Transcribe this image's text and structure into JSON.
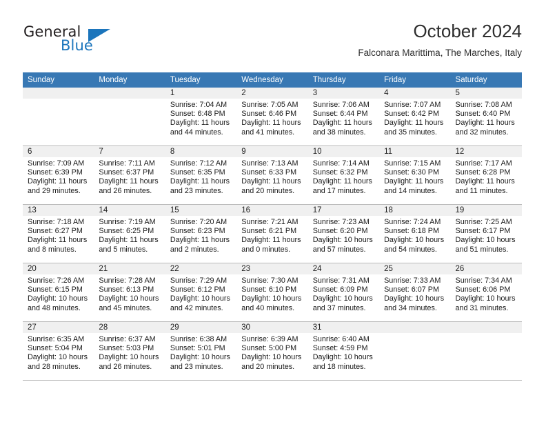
{
  "brand": {
    "name_top": "General",
    "name_bottom": "Blue",
    "accent_color": "#1b75bc"
  },
  "header": {
    "title": "October 2024",
    "subtitle": "Falconara Marittima, The Marches, Italy"
  },
  "theme": {
    "header_row_bg": "#3878b4",
    "daynum_band_bg": "#f0f0f0",
    "grid_line": "#b9b9b9",
    "text": "#1a1a1a"
  },
  "calendar": {
    "weekday_headers": [
      "Sunday",
      "Monday",
      "Tuesday",
      "Wednesday",
      "Thursday",
      "Friday",
      "Saturday"
    ],
    "weeks": [
      [
        {
          "day": "",
          "sunrise": "",
          "sunset": "",
          "daylight_1": "",
          "daylight_2": ""
        },
        {
          "day": "",
          "sunrise": "",
          "sunset": "",
          "daylight_1": "",
          "daylight_2": ""
        },
        {
          "day": "1",
          "sunrise": "Sunrise: 7:04 AM",
          "sunset": "Sunset: 6:48 PM",
          "daylight_1": "Daylight: 11 hours",
          "daylight_2": "and 44 minutes."
        },
        {
          "day": "2",
          "sunrise": "Sunrise: 7:05 AM",
          "sunset": "Sunset: 6:46 PM",
          "daylight_1": "Daylight: 11 hours",
          "daylight_2": "and 41 minutes."
        },
        {
          "day": "3",
          "sunrise": "Sunrise: 7:06 AM",
          "sunset": "Sunset: 6:44 PM",
          "daylight_1": "Daylight: 11 hours",
          "daylight_2": "and 38 minutes."
        },
        {
          "day": "4",
          "sunrise": "Sunrise: 7:07 AM",
          "sunset": "Sunset: 6:42 PM",
          "daylight_1": "Daylight: 11 hours",
          "daylight_2": "and 35 minutes."
        },
        {
          "day": "5",
          "sunrise": "Sunrise: 7:08 AM",
          "sunset": "Sunset: 6:40 PM",
          "daylight_1": "Daylight: 11 hours",
          "daylight_2": "and 32 minutes."
        }
      ],
      [
        {
          "day": "6",
          "sunrise": "Sunrise: 7:09 AM",
          "sunset": "Sunset: 6:39 PM",
          "daylight_1": "Daylight: 11 hours",
          "daylight_2": "and 29 minutes."
        },
        {
          "day": "7",
          "sunrise": "Sunrise: 7:11 AM",
          "sunset": "Sunset: 6:37 PM",
          "daylight_1": "Daylight: 11 hours",
          "daylight_2": "and 26 minutes."
        },
        {
          "day": "8",
          "sunrise": "Sunrise: 7:12 AM",
          "sunset": "Sunset: 6:35 PM",
          "daylight_1": "Daylight: 11 hours",
          "daylight_2": "and 23 minutes."
        },
        {
          "day": "9",
          "sunrise": "Sunrise: 7:13 AM",
          "sunset": "Sunset: 6:33 PM",
          "daylight_1": "Daylight: 11 hours",
          "daylight_2": "and 20 minutes."
        },
        {
          "day": "10",
          "sunrise": "Sunrise: 7:14 AM",
          "sunset": "Sunset: 6:32 PM",
          "daylight_1": "Daylight: 11 hours",
          "daylight_2": "and 17 minutes."
        },
        {
          "day": "11",
          "sunrise": "Sunrise: 7:15 AM",
          "sunset": "Sunset: 6:30 PM",
          "daylight_1": "Daylight: 11 hours",
          "daylight_2": "and 14 minutes."
        },
        {
          "day": "12",
          "sunrise": "Sunrise: 7:17 AM",
          "sunset": "Sunset: 6:28 PM",
          "daylight_1": "Daylight: 11 hours",
          "daylight_2": "and 11 minutes."
        }
      ],
      [
        {
          "day": "13",
          "sunrise": "Sunrise: 7:18 AM",
          "sunset": "Sunset: 6:27 PM",
          "daylight_1": "Daylight: 11 hours",
          "daylight_2": "and 8 minutes."
        },
        {
          "day": "14",
          "sunrise": "Sunrise: 7:19 AM",
          "sunset": "Sunset: 6:25 PM",
          "daylight_1": "Daylight: 11 hours",
          "daylight_2": "and 5 minutes."
        },
        {
          "day": "15",
          "sunrise": "Sunrise: 7:20 AM",
          "sunset": "Sunset: 6:23 PM",
          "daylight_1": "Daylight: 11 hours",
          "daylight_2": "and 2 minutes."
        },
        {
          "day": "16",
          "sunrise": "Sunrise: 7:21 AM",
          "sunset": "Sunset: 6:21 PM",
          "daylight_1": "Daylight: 11 hours",
          "daylight_2": "and 0 minutes."
        },
        {
          "day": "17",
          "sunrise": "Sunrise: 7:23 AM",
          "sunset": "Sunset: 6:20 PM",
          "daylight_1": "Daylight: 10 hours",
          "daylight_2": "and 57 minutes."
        },
        {
          "day": "18",
          "sunrise": "Sunrise: 7:24 AM",
          "sunset": "Sunset: 6:18 PM",
          "daylight_1": "Daylight: 10 hours",
          "daylight_2": "and 54 minutes."
        },
        {
          "day": "19",
          "sunrise": "Sunrise: 7:25 AM",
          "sunset": "Sunset: 6:17 PM",
          "daylight_1": "Daylight: 10 hours",
          "daylight_2": "and 51 minutes."
        }
      ],
      [
        {
          "day": "20",
          "sunrise": "Sunrise: 7:26 AM",
          "sunset": "Sunset: 6:15 PM",
          "daylight_1": "Daylight: 10 hours",
          "daylight_2": "and 48 minutes."
        },
        {
          "day": "21",
          "sunrise": "Sunrise: 7:28 AM",
          "sunset": "Sunset: 6:13 PM",
          "daylight_1": "Daylight: 10 hours",
          "daylight_2": "and 45 minutes."
        },
        {
          "day": "22",
          "sunrise": "Sunrise: 7:29 AM",
          "sunset": "Sunset: 6:12 PM",
          "daylight_1": "Daylight: 10 hours",
          "daylight_2": "and 42 minutes."
        },
        {
          "day": "23",
          "sunrise": "Sunrise: 7:30 AM",
          "sunset": "Sunset: 6:10 PM",
          "daylight_1": "Daylight: 10 hours",
          "daylight_2": "and 40 minutes."
        },
        {
          "day": "24",
          "sunrise": "Sunrise: 7:31 AM",
          "sunset": "Sunset: 6:09 PM",
          "daylight_1": "Daylight: 10 hours",
          "daylight_2": "and 37 minutes."
        },
        {
          "day": "25",
          "sunrise": "Sunrise: 7:33 AM",
          "sunset": "Sunset: 6:07 PM",
          "daylight_1": "Daylight: 10 hours",
          "daylight_2": "and 34 minutes."
        },
        {
          "day": "26",
          "sunrise": "Sunrise: 7:34 AM",
          "sunset": "Sunset: 6:06 PM",
          "daylight_1": "Daylight: 10 hours",
          "daylight_2": "and 31 minutes."
        }
      ],
      [
        {
          "day": "27",
          "sunrise": "Sunrise: 6:35 AM",
          "sunset": "Sunset: 5:04 PM",
          "daylight_1": "Daylight: 10 hours",
          "daylight_2": "and 28 minutes."
        },
        {
          "day": "28",
          "sunrise": "Sunrise: 6:37 AM",
          "sunset": "Sunset: 5:03 PM",
          "daylight_1": "Daylight: 10 hours",
          "daylight_2": "and 26 minutes."
        },
        {
          "day": "29",
          "sunrise": "Sunrise: 6:38 AM",
          "sunset": "Sunset: 5:01 PM",
          "daylight_1": "Daylight: 10 hours",
          "daylight_2": "and 23 minutes."
        },
        {
          "day": "30",
          "sunrise": "Sunrise: 6:39 AM",
          "sunset": "Sunset: 5:00 PM",
          "daylight_1": "Daylight: 10 hours",
          "daylight_2": "and 20 minutes."
        },
        {
          "day": "31",
          "sunrise": "Sunrise: 6:40 AM",
          "sunset": "Sunset: 4:59 PM",
          "daylight_1": "Daylight: 10 hours",
          "daylight_2": "and 18 minutes."
        },
        {
          "day": "",
          "sunrise": "",
          "sunset": "",
          "daylight_1": "",
          "daylight_2": ""
        },
        {
          "day": "",
          "sunrise": "",
          "sunset": "",
          "daylight_1": "",
          "daylight_2": ""
        }
      ]
    ]
  }
}
